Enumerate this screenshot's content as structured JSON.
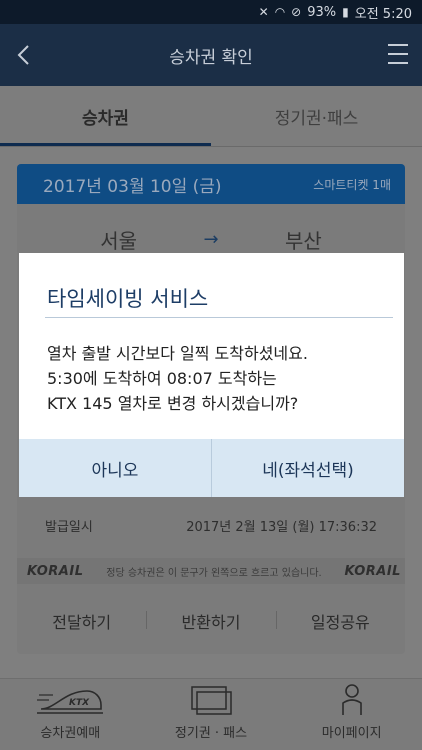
{
  "status_bar": {
    "battery": "93%",
    "time": "오전 5:20"
  },
  "header": {
    "title": "승차권 확인"
  },
  "tabs": [
    {
      "label": "승차권"
    },
    {
      "label": "정기권·패스"
    }
  ],
  "ticket": {
    "date": "2017년 03월 10일 (금)",
    "kind": "스마트티켓 1매",
    "from": "서울",
    "to": "부산",
    "issue_label": "발급일시",
    "issue_value": "2017년 2월 13일 (월) 17:36:32",
    "korail_logo": "KORAIL",
    "notice": "정당 승차권은 이 문구가 왼쪽으로 흐르고 있습니다.",
    "actions": [
      {
        "label": "전달하기"
      },
      {
        "label": "반환하기"
      },
      {
        "label": "일정공유"
      }
    ]
  },
  "bottom_nav": [
    {
      "label": "승차권예매",
      "icon": "ktx-train-icon"
    },
    {
      "label": "정기권 · 패스",
      "icon": "pass-cards-icon"
    },
    {
      "label": "마이페이지",
      "icon": "person-icon"
    }
  ],
  "dialog": {
    "title": "타임세이빙 서비스",
    "lines": [
      "열차 출발 시간보다 일찍 도착하셨네요.",
      "5:30에 도착하여 08:07 도착하는",
      "KTX 145 열차로 변경 하시겠습니까?"
    ],
    "cancel_label": "아니오",
    "confirm_label": "네(좌석선택)"
  }
}
